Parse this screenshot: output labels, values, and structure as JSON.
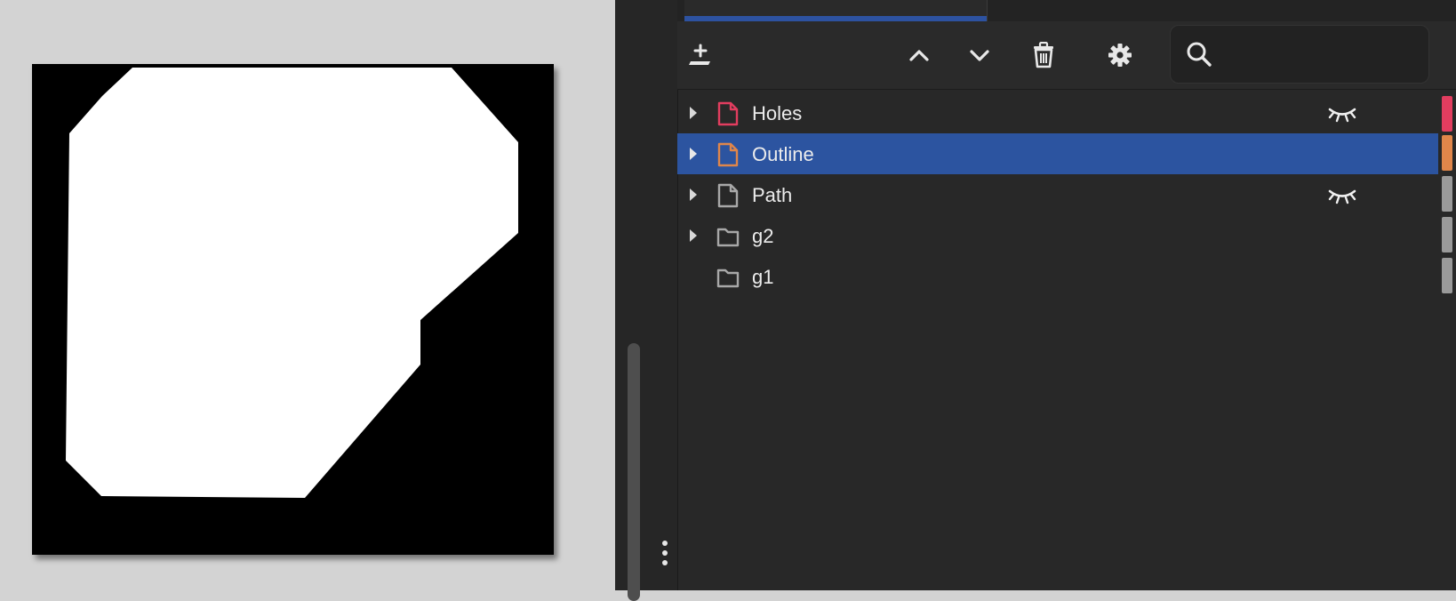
{
  "canvas": {
    "shape_name": "Outline"
  },
  "panel": {
    "toolbar": {
      "add_layer": "add-layer-icon",
      "move_up": "chevron-up-icon",
      "move_down": "chevron-down-icon",
      "delete": "trash-icon",
      "settings": "gear-icon",
      "search": "search-icon",
      "search_value": ""
    },
    "layers": [
      {
        "label": "Holes",
        "type": "path",
        "expandable": true,
        "hidden": true,
        "selected": false,
        "color": "#e23d5f"
      },
      {
        "label": "Outline",
        "type": "path",
        "expandable": true,
        "hidden": false,
        "selected": true,
        "color": "#e0864a"
      },
      {
        "label": "Path",
        "type": "path",
        "expandable": true,
        "hidden": true,
        "selected": false,
        "color": "#9a9a9a"
      },
      {
        "label": "g2",
        "type": "group",
        "expandable": true,
        "hidden": false,
        "selected": false,
        "color": "#9a9a9a"
      },
      {
        "label": "g1",
        "type": "group",
        "expandable": false,
        "hidden": false,
        "selected": false,
        "color": "#9a9a9a"
      }
    ],
    "colors": {
      "selection": "#2c54a0",
      "tab_accent": "#2d52a0"
    }
  }
}
